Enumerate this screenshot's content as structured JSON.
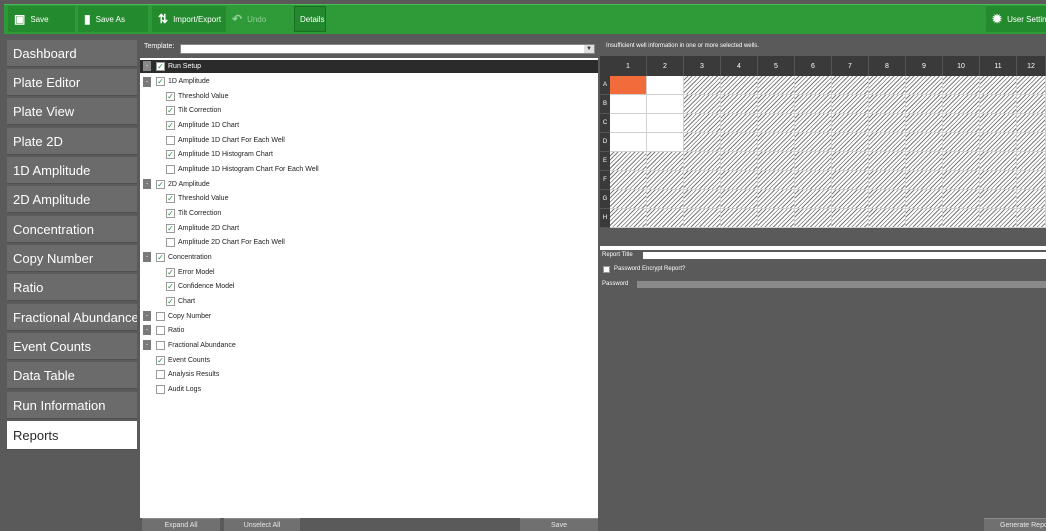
{
  "toolbar": {
    "save": "Save",
    "save_as": "Save As",
    "import_export": "Import/Export",
    "undo": "Undo",
    "details": "Details",
    "user_settings": "User Settings",
    "save_icon": "floppy-disk-icon",
    "save_as_icon": "document-icon",
    "import_export_icon": "up-down-arrows-icon",
    "undo_icon": "undo-arrow-icon",
    "settings_icon": "gear-icon"
  },
  "nav": {
    "items": [
      "Dashboard",
      "Plate Editor",
      "Plate View",
      "Plate 2D",
      "1D Amplitude",
      "2D Amplitude",
      "Concentration",
      "Copy Number",
      "Ratio",
      "Fractional Abundance",
      "Event Counts",
      "Data Table",
      "Run Information",
      "Reports"
    ],
    "active": "Reports"
  },
  "template": {
    "label": "Template:",
    "value": ""
  },
  "tree": {
    "run_setup": "Run Setup",
    "amp1d": "1D Amplitude",
    "amp1d_threshold": "Threshold Value",
    "amp1d_tilt": "Tilt Correction",
    "amp1d_chart": "Amplitude 1D Chart",
    "amp1d_chart_each": "Amplitude 1D Chart For Each Well",
    "amp1d_hist": "Amplitude 1D Histogram Chart",
    "amp1d_hist_each": "Amplitude 1D Histogram Chart For Each Well",
    "amp2d": "2D Amplitude",
    "amp2d_threshold": "Threshold Value",
    "amp2d_tilt": "Tilt Correction",
    "amp2d_chart": "Amplitude 2D Chart",
    "amp2d_chart_each": "Amplitude 2D Chart For Each Well",
    "conc": "Concentration",
    "conc_error": "Error Model",
    "conc_conf": "Confidence Model",
    "conc_chart": "Chart",
    "copy_number": "Copy Number",
    "ratio": "Ratio",
    "frac": "Fractional Abundance",
    "event_counts": "Event Counts",
    "analysis": "Analysis Results",
    "audit": "Audit Logs",
    "check": "✓",
    "minus": "-"
  },
  "buttons": {
    "expand_all": "Expand All",
    "unselect_all": "Unselect All",
    "save": "Save",
    "generate_report": "Generate Report"
  },
  "plate": {
    "warning": "Insufficient well information in one or more selected wells.",
    "columns": [
      "1",
      "2",
      "3",
      "4",
      "5",
      "6",
      "7",
      "8",
      "9",
      "10",
      "11",
      "12"
    ],
    "rows": [
      "A",
      "B",
      "C",
      "D",
      "E",
      "F",
      "G",
      "H"
    ],
    "selected_well": "A1",
    "selected_color": "#f26b3a"
  },
  "report": {
    "title_label": "Report Title",
    "encrypt_label": "Password Encrypt Report?",
    "password_label": "Password"
  },
  "colors": {
    "accent": "#2e9a38",
    "panel": "#5a5a5a"
  }
}
